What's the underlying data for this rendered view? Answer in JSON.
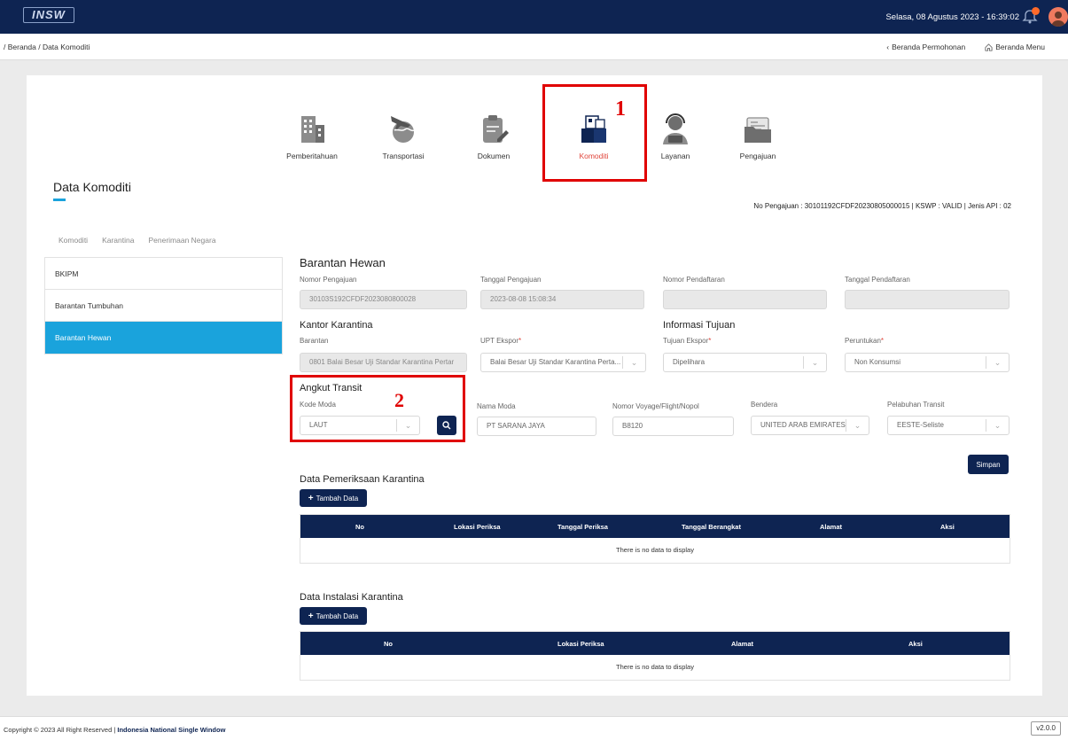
{
  "header": {
    "logo_text": "INSW",
    "datetime": "Selasa, 08 Agustus 2023 - 16:39:02"
  },
  "subbar": {
    "breadcrumb": "/ Beranda / Data Komoditi",
    "link_permohonan": "Beranda Permohonan",
    "link_menu": "Beranda Menu"
  },
  "steps": [
    {
      "label": "Pemberitahuan",
      "icon": "building-icon"
    },
    {
      "label": "Transportasi",
      "icon": "plane-globe-icon"
    },
    {
      "label": "Dokumen",
      "icon": "clipboard-edit-icon"
    },
    {
      "label": "Komoditi",
      "icon": "boxes-icon",
      "active": true
    },
    {
      "label": "Layanan",
      "icon": "support-agent-icon"
    },
    {
      "label": "Pengajuan",
      "icon": "folder-doc-icon"
    }
  ],
  "annotations": {
    "one": "1",
    "two": "2"
  },
  "page": {
    "title": "Data Komoditi",
    "info": "No Pengajuan : 30101192CFDF20230805000015 | KSWP : VALID | Jenis API : 02"
  },
  "tabs": [
    "Komoditi",
    "Karantina",
    "Penerimaan Negara"
  ],
  "side_menu": [
    "BKIPM",
    "Barantan Tumbuhan",
    "Barantan Hewan"
  ],
  "form": {
    "section_title": "Barantan Hewan",
    "nomor_pengajuan_label": "Nomor Pengajuan",
    "nomor_pengajuan_value": "30103S192CFDF2023080800028",
    "tanggal_pengajuan_label": "Tanggal Pengajuan",
    "tanggal_pengajuan_value": "2023-08-08 15:08:34",
    "nomor_pendaftaran_label": "Nomor Pendaftaran",
    "nomor_pendaftaran_value": "",
    "tanggal_pendaftaran_label": "Tanggal Pendaftaran",
    "tanggal_pendaftaran_value": "",
    "kantor_title": "Kantor Karantina",
    "barantan_label": "Barantan",
    "barantan_value": "0801 Balai Besar Uji Standar Karantina Pertar",
    "upt_label": "UPT Ekspor",
    "upt_value": "Balai Besar Uji Standar Karantina Perta...",
    "info_tujuan_title": "Informasi Tujuan",
    "tujuan_label": "Tujuan Ekspor",
    "tujuan_value": "Dipelihara",
    "peruntukan_label": "Peruntukan",
    "peruntukan_value": "Non Konsumsi",
    "angkut_title": "Angkut Transit",
    "kode_moda_label": "Kode Moda",
    "kode_moda_value": "LAUT",
    "nama_moda_label": "Nama Moda",
    "nama_moda_value": "PT SARANA JAYA",
    "voyage_label": "Nomor Voyage/Flight/Nopol",
    "voyage_value": "B8120",
    "bendera_label": "Bendera",
    "bendera_value": "UNITED ARAB EMIRATES",
    "pelabuhan_label": "Pelabuhan Transit",
    "pelabuhan_value": "EESTE-Seliste",
    "required_mark": "*",
    "simpan_label": "Simpan"
  },
  "pemeriksaan": {
    "title": "Data Pemeriksaan Karantina",
    "add_label": "Tambah Data",
    "columns": [
      "No",
      "Lokasi Periksa",
      "Tanggal Periksa",
      "Tanggal Berangkat",
      "Alamat",
      "Aksi"
    ],
    "empty": "There is no data to display"
  },
  "instalasi": {
    "title": "Data Instalasi Karantina",
    "add_label": "Tambah Data",
    "columns": [
      "No",
      "Lokasi Periksa",
      "Alamat",
      "Aksi"
    ],
    "empty": "There is no data to display"
  },
  "footer": {
    "copyright": "Copyright © 2023 All Right Reserved |",
    "brand": "Indonesia National Single Window",
    "version": "v2.0.0"
  },
  "colors": {
    "navy": "#0e2452",
    "accent": "#1aa3dc",
    "highlight": "#e00000",
    "required": "#e0443a"
  }
}
